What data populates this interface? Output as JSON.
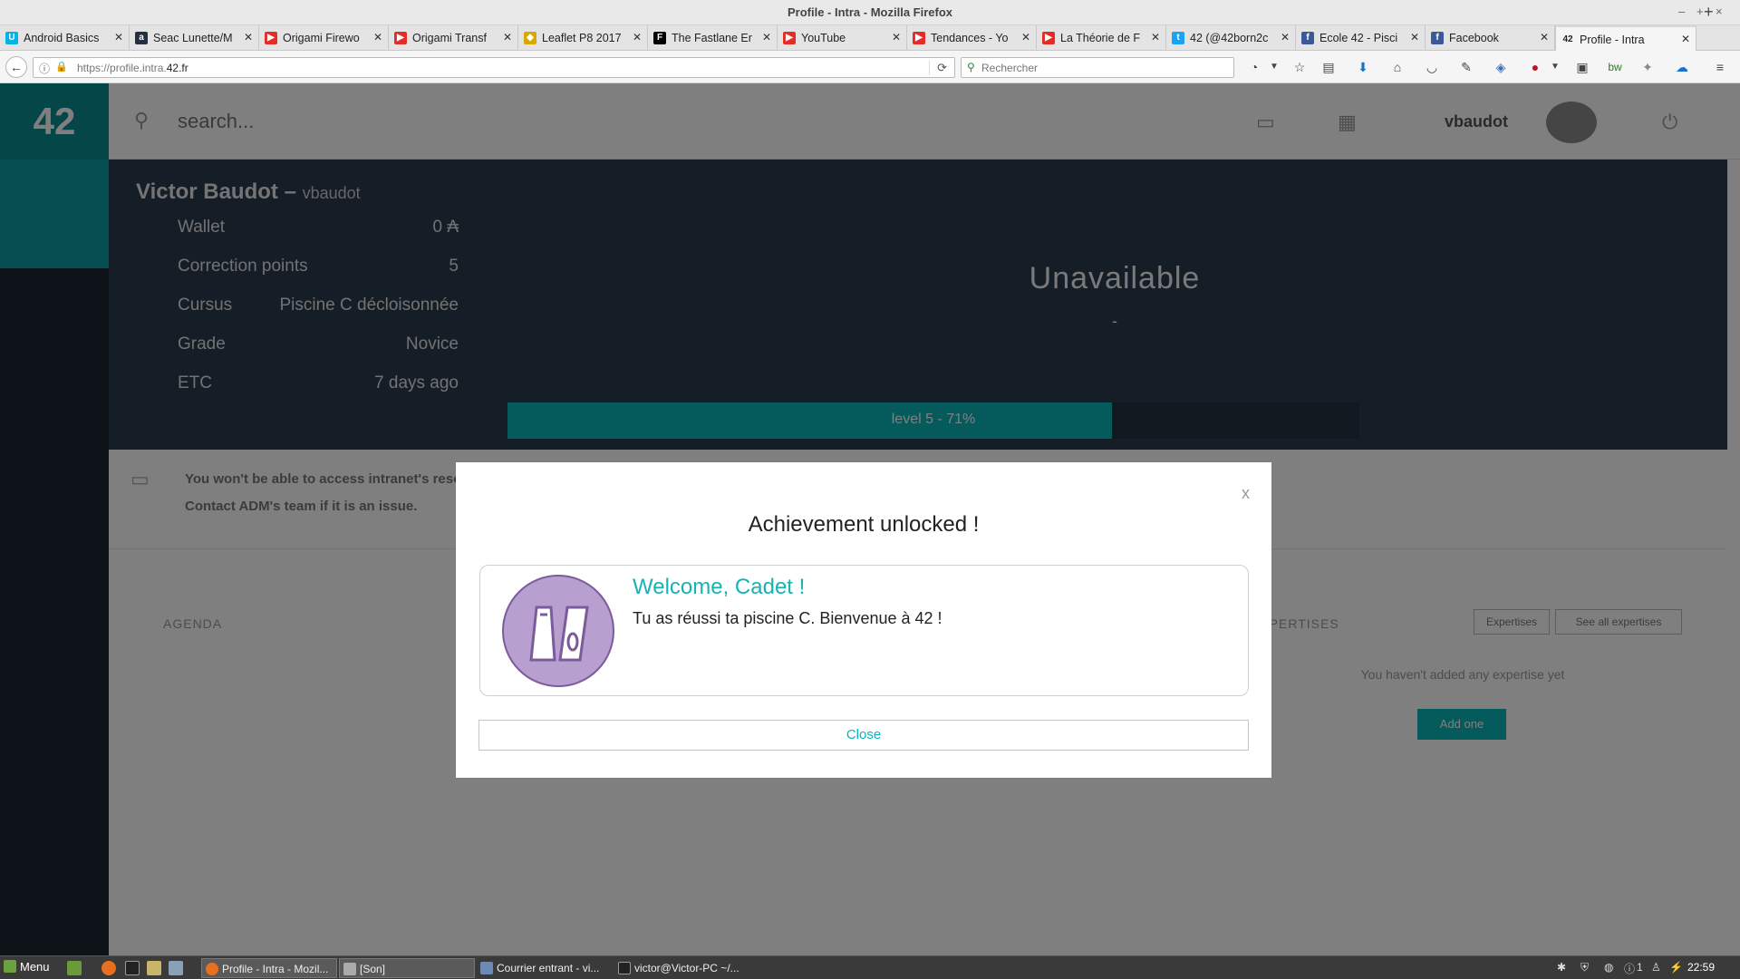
{
  "window": {
    "title": "Profile - Intra - Mozilla Firefox",
    "controls": [
      "–",
      "+",
      "×"
    ]
  },
  "tabs": [
    {
      "label": "Android Basics",
      "icon": "udacity-icon",
      "color": "#02b3e4",
      "glyph": "U"
    },
    {
      "label": "Seac Lunette/M",
      "icon": "amazon-icon",
      "color": "#232f3e",
      "glyph": "a"
    },
    {
      "label": "Origami Firewo",
      "icon": "youtube-icon",
      "color": "#e52d27",
      "glyph": "▶"
    },
    {
      "label": "Origami Transf",
      "icon": "youtube-icon",
      "color": "#e52d27",
      "glyph": "▶"
    },
    {
      "label": "Leaflet P8 2017",
      "icon": "document-icon",
      "color": "#d9a800",
      "glyph": "◆"
    },
    {
      "label": "The Fastlane Er",
      "icon": "fastlane-icon",
      "color": "#000000",
      "glyph": "F"
    },
    {
      "label": "YouTube",
      "icon": "youtube-icon",
      "color": "#e52d27",
      "glyph": "▶"
    },
    {
      "label": "Tendances - Yo",
      "icon": "youtube-icon",
      "color": "#e52d27",
      "glyph": "▶"
    },
    {
      "label": "La Théorie de F",
      "icon": "youtube-icon",
      "color": "#e52d27",
      "glyph": "▶"
    },
    {
      "label": "42 (@42born2c",
      "icon": "twitter-icon",
      "color": "#1da1f2",
      "glyph": "t"
    },
    {
      "label": "Ecole 42 - Pisci",
      "icon": "facebook-icon",
      "color": "#3b5998",
      "glyph": "f"
    },
    {
      "label": "Facebook",
      "icon": "facebook-icon",
      "color": "#3b5998",
      "glyph": "f"
    },
    {
      "label": "Profile - Intra",
      "icon": "42-icon",
      "color": "#222222",
      "glyph": "42",
      "active": true
    }
  ],
  "navbar": {
    "url_prefix": "https://profile.intra.",
    "url_domain": "42.fr",
    "search_placeholder": "Rechercher"
  },
  "page": {
    "logo": "42",
    "search_placeholder": "search...",
    "login": "vbaudot",
    "profile": {
      "name": "Victor Baudot",
      "separator": " – ",
      "login": "vbaudot",
      "rows": [
        {
          "key": "Wallet",
          "value": "0 ₳"
        },
        {
          "key": "Correction points",
          "value": "5"
        },
        {
          "key": "Cursus",
          "value": "Piscine C décloisonnée"
        },
        {
          "key": "Grade",
          "value": "Novice"
        },
        {
          "key": "ETC",
          "value": "7 days ago"
        }
      ],
      "status": "Unavailable",
      "status_sub": "-",
      "level_text": "level 5 - 71%",
      "level_progress": 0.71
    },
    "notice": {
      "line1": "You won't be able to access intranet's reso",
      "line2": "Contact ADM's team if it is an issue."
    },
    "agenda_label": "AGENDA",
    "events_label": "EXPERTISES",
    "expertises_button": "Expertises",
    "see_all_button": "See all expertises",
    "no_expertise": "You haven't added any expertise yet",
    "add_one": "Add one"
  },
  "modal": {
    "title": "Achievement unlocked !",
    "close_x": "x",
    "achievement_title": "Welcome, Cadet !",
    "achievement_desc": "Tu as réussi ta piscine C. Bienvenue à 42 !",
    "close_button": "Close",
    "accent": "#15b3b4",
    "badge_color": "#b7a0d0"
  },
  "taskbar": {
    "menu": "Menu",
    "tasks": [
      {
        "label": "Profile - Intra - Mozil...",
        "active": true
      },
      {
        "label": "[Son]",
        "active": true
      },
      {
        "label": "Courrier entrant - vi...",
        "active": false
      },
      {
        "label": "victor@Victor-PC ~/...",
        "active": false
      }
    ],
    "tray_text": "1",
    "clock": "22:59"
  }
}
